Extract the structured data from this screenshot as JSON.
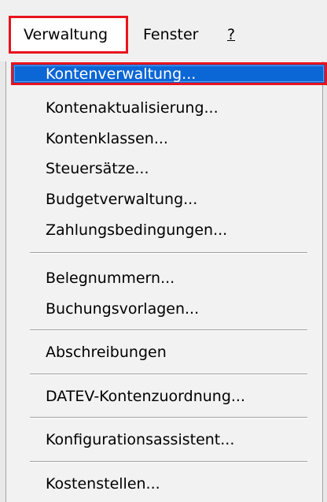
{
  "menubar": {
    "items": [
      {
        "label": "Verwaltung"
      },
      {
        "label": "Fenster"
      },
      {
        "label": "?"
      }
    ]
  },
  "menu": {
    "items": [
      {
        "label": "Kontenverwaltung..."
      },
      {
        "label": "Kontenaktualisierung..."
      },
      {
        "label": "Kontenklassen..."
      },
      {
        "label": "Steuersätze..."
      },
      {
        "label": "Budgetverwaltung..."
      },
      {
        "label": "Zahlungsbedingungen..."
      },
      {
        "label": "Belegnummern..."
      },
      {
        "label": "Buchungsvorlagen..."
      },
      {
        "label": "Abschreibungen"
      },
      {
        "label": "DATEV-Kontenzuordnung..."
      },
      {
        "label": "Konfigurationsassistent..."
      },
      {
        "label": "Kostenstellen..."
      }
    ]
  },
  "colors": {
    "highlight_border": "#e8141e",
    "selection": "#0b66d6",
    "menu_background": "#f2f2f2"
  }
}
